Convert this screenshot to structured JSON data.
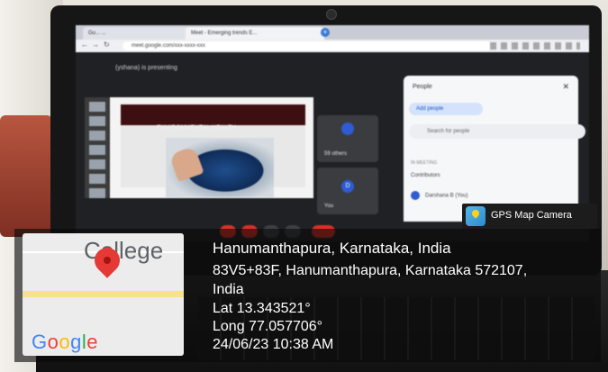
{
  "browser": {
    "tab1_title": "Gu... ...",
    "tab2_title": "Meet - Emerging trends E...",
    "url": "meet.google.com/xxx-xxxx-xxx"
  },
  "meet": {
    "presenting_label": "(yshana) is presenting",
    "slide_title": "ENVIRONMENTAL HEALTH",
    "tile_others_label": "59 others",
    "tile_you_label": "You",
    "tile_you_initial": "D"
  },
  "people_panel": {
    "title": "People",
    "add_people": "Add people",
    "search_placeholder": "Search for people",
    "section_label": "IN MEETING",
    "contributors_label": "Contributors",
    "row1_name": "Darshana B (You)"
  },
  "gps_badge": {
    "label": "GPS Map Camera"
  },
  "map": {
    "place_label": "College",
    "logo_text": "Google"
  },
  "location": {
    "line1": "Hanumanthapura, Karnataka, India",
    "line2": "83V5+83F, Hanumanthapura, Karnataka 572107,",
    "line3": "India",
    "lat": "Lat 13.343521°",
    "long": "Long 77.057706°",
    "datetime": "24/06/23 10:38 AM"
  },
  "colors": {
    "pin": "#e53935",
    "google": [
      "#4285F4",
      "#EA4335",
      "#FBBC05",
      "#4285F4",
      "#34A853",
      "#EA4335"
    ]
  }
}
